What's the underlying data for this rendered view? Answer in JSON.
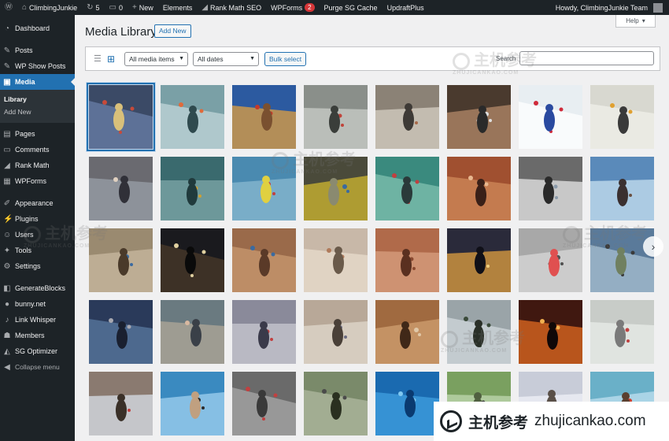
{
  "adminbar": {
    "site_name": "ClimbingJunkie",
    "updates_count": "5",
    "comments_count": "0",
    "new_label": "New",
    "elements_label": "Elements",
    "rankmath_label": "Rank Math SEO",
    "wpforms_label": "WPForms",
    "wpforms_badge": "2",
    "purge_label": "Purge SG Cache",
    "updraft_label": "UpdraftPlus",
    "howdy": "Howdy, ClimbingJunkie Team"
  },
  "sidebar": {
    "items": [
      {
        "label": "Dashboard",
        "icon": "dashboard-icon"
      },
      {
        "label": "Posts",
        "icon": "pin-icon"
      },
      {
        "label": "WP Show Posts",
        "icon": "pin-icon"
      },
      {
        "label": "Media",
        "icon": "media-icon"
      },
      {
        "label": "Pages",
        "icon": "page-icon"
      },
      {
        "label": "Comments",
        "icon": "comment-icon"
      },
      {
        "label": "Rank Math",
        "icon": "rankmath-icon"
      },
      {
        "label": "WPForms",
        "icon": "form-icon"
      },
      {
        "label": "Appearance",
        "icon": "brush-icon"
      },
      {
        "label": "Plugins",
        "icon": "plugin-icon"
      },
      {
        "label": "Users",
        "icon": "user-icon"
      },
      {
        "label": "Tools",
        "icon": "wrench-icon"
      },
      {
        "label": "Settings",
        "icon": "settings-icon"
      },
      {
        "label": "GenerateBlocks",
        "icon": "blocks-icon"
      },
      {
        "label": "bunny.net",
        "icon": "bunny-icon"
      },
      {
        "label": "Link Whisper",
        "icon": "link-icon"
      },
      {
        "label": "Members",
        "icon": "members-icon"
      },
      {
        "label": "SG Optimizer",
        "icon": "sg-icon"
      },
      {
        "label": "Collapse menu",
        "icon": "collapse-icon"
      }
    ],
    "submenu": [
      "Library",
      "Add New"
    ]
  },
  "main": {
    "title": "Media Library",
    "add_new": "Add New",
    "help": "Help",
    "filter_type": "All media items",
    "filter_date": "All dates",
    "bulk_select": "Bulk select",
    "search_label": "Search"
  },
  "watermark": {
    "cn": "主机参考",
    "en": "zhujicankao.com",
    "sub": "ZHUJICANKAO.COM"
  },
  "colors": {
    "accent": "#2271b1",
    "admin_dark": "#1d2327"
  }
}
